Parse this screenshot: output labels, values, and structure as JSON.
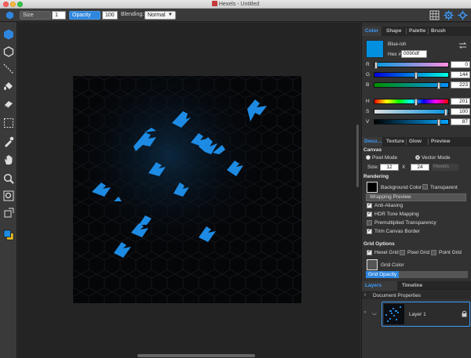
{
  "window": {
    "title": "Hexels - Untitled"
  },
  "tool_options": {
    "size_label": "Size",
    "size_value": "1",
    "opacity_label": "Opacity",
    "opacity_value": "100",
    "blending_label": "Blending:",
    "blending_value": "Normal"
  },
  "color_panel": {
    "tabs": [
      "Color",
      "Shape",
      "Palette",
      "Brush"
    ],
    "active_tab": "Color",
    "color_name": "Blue-ish",
    "hex_label": "Hex #:",
    "hex_value": "0090df",
    "current_color": "#0090df",
    "rgb": [
      {
        "label": "R",
        "value": "0",
        "fraction": 0.0
      },
      {
        "label": "G",
        "value": "144",
        "fraction": 0.565
      },
      {
        "label": "B",
        "value": "223",
        "fraction": 0.875
      }
    ],
    "hsv": [
      {
        "label": "H",
        "value": "201",
        "fraction": 0.56
      },
      {
        "label": "S",
        "value": "100",
        "fraction": 1.0
      },
      {
        "label": "V",
        "value": "87",
        "fraction": 0.87
      }
    ]
  },
  "doc_panel": {
    "tabs": [
      "Docu…",
      "Texture",
      "Glow",
      "Preview"
    ],
    "active_tab": "Docu…",
    "canvas_header": "Canvas",
    "pixel_mode": "Pixel Mode",
    "vector_mode": "Vector Mode",
    "size_label": "Size:",
    "size_w": "12",
    "size_x": "X",
    "size_h": "24",
    "size_unit": "Hexels",
    "rendering_header": "Rendering",
    "background_color_label": "Background Color",
    "transparent_label": "Transparent",
    "wrapping_preview_label": "Wrapping Preview",
    "anti_aliasing_label": "Anti-Aliasing",
    "hdr_label": "HDR Tone Mapping",
    "premult_label": "Premultiplied Transparency",
    "trim_label": "Trim Canvas Border",
    "grid_header": "Grid Options",
    "hexel_grid_label": "Hexel Grid",
    "pixel_grid_label": "Pixel Grid",
    "point_grid_label": "Point Grid",
    "grid_color_label": "Grid Color",
    "grid_opacity_label": "Grid Opacity",
    "grid_opacity_fraction": 0.32
  },
  "layers_panel": {
    "tabs": [
      "Layers",
      "Timeline"
    ],
    "active_tab": "Layers",
    "doc_properties": "Document Properties",
    "layer_name": "Layer 1"
  },
  "icons": {
    "toolbar": [
      "hex-select-icon",
      "hex-outline-icon",
      "line-icon",
      "fill-bucket-icon",
      "eraser-icon",
      "marquee-icon",
      "eyedropper-icon",
      "hand-icon",
      "zoom-icon",
      "zoom-fit-icon",
      "transform-icon",
      "color-swatch-icon"
    ],
    "top_right": [
      "grid-view-icon",
      "gear-icon",
      "settings-icon"
    ]
  },
  "colors": {
    "accent": "#2f86de",
    "shape_blue": "#1d8be3",
    "canvas_bg": "#050608"
  }
}
